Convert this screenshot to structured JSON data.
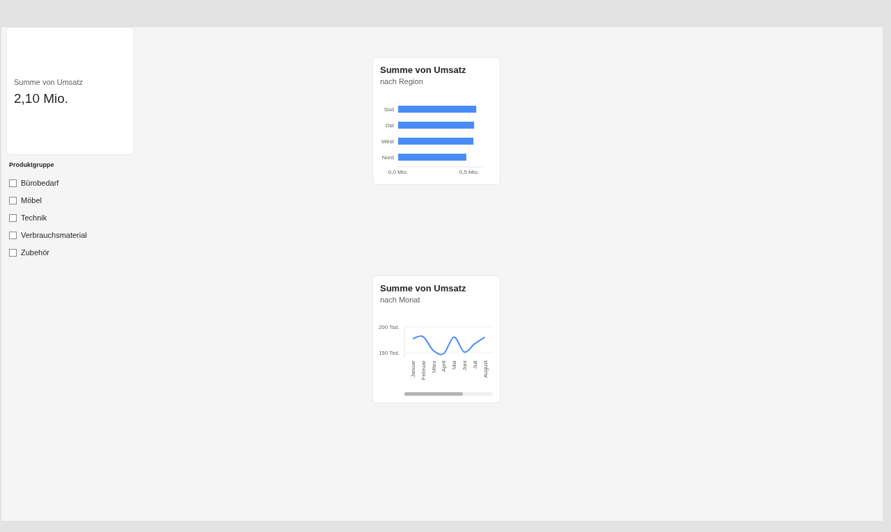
{
  "kpi_card": {
    "label": "Summe von Umsatz",
    "value": "2,10 Mio."
  },
  "slicer": {
    "title": "Produktgruppe",
    "items": [
      {
        "label": "Bürobedarf",
        "checked": false
      },
      {
        "label": "Möbel",
        "checked": false
      },
      {
        "label": "Technik",
        "checked": false
      },
      {
        "label": "Verbrauchsmaterial",
        "checked": false
      },
      {
        "label": "Zubehör",
        "checked": false
      }
    ]
  },
  "region_chart": {
    "title": "Summe von Umsatz",
    "subtitle": "nach Region",
    "chart_data": {
      "type": "bar",
      "orientation": "horizontal",
      "categories": [
        "Süd",
        "Ost",
        "West",
        "Nord"
      ],
      "series": [
        {
          "color": "#4a8cf7",
          "values": [
            0.55,
            0.535,
            0.53,
            0.48
          ]
        }
      ],
      "xlim": [
        0,
        0.6
      ],
      "xticks": [
        {
          "value": 0,
          "label": "0,0 Mio."
        },
        {
          "value": 0.5,
          "label": "0,5 Mio."
        }
      ]
    }
  },
  "month_chart": {
    "title": "Summe von Umsatz",
    "subtitle": "nach Monat",
    "chart_data": {
      "type": "line",
      "categories": [
        "Januar",
        "Februar",
        "März",
        "April",
        "Mai",
        "Juni",
        "Juli",
        "August"
      ],
      "series": [
        {
          "color": "#4a8cf7",
          "values": [
            177,
            181,
            154,
            148,
            180,
            151,
            167,
            180
          ]
        }
      ],
      "ylim": [
        140,
        200
      ],
      "yticks": [
        {
          "value": 150,
          "label": "150 Tsd."
        },
        {
          "value": 200,
          "label": "200 Tsd."
        }
      ]
    }
  }
}
